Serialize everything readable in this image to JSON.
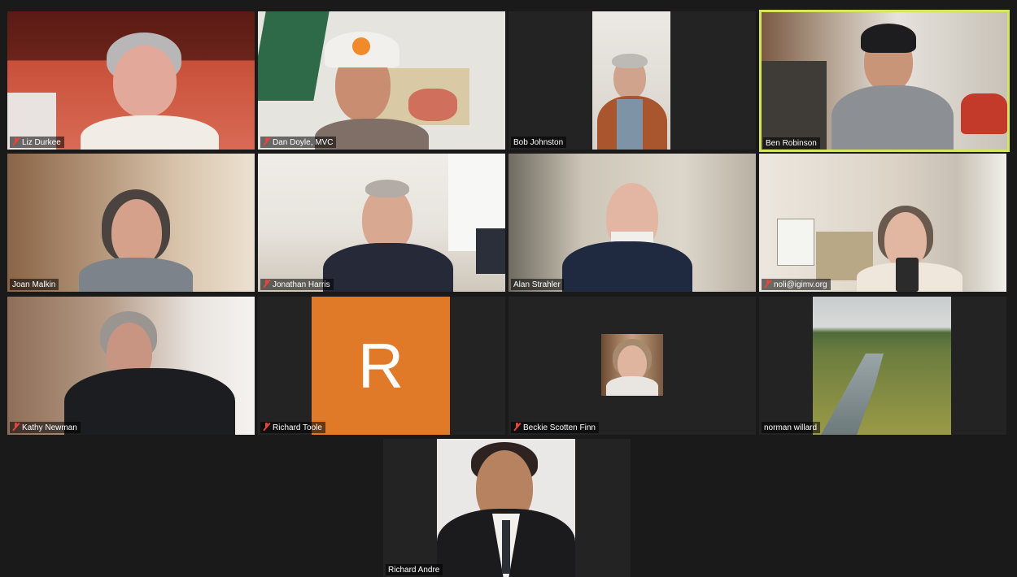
{
  "participants": [
    {
      "name": "Liz Durkee",
      "muted": true
    },
    {
      "name": "Dan Doyle, MVC",
      "muted": true
    },
    {
      "name": "Bob Johnston",
      "muted": false
    },
    {
      "name": "Ben Robinson",
      "muted": false,
      "active_speaker": true
    },
    {
      "name": "Joan Malkin",
      "muted": false
    },
    {
      "name": "Jonathan Harris",
      "muted": true
    },
    {
      "name": "Alan Strahler",
      "muted": false
    },
    {
      "name": "noli@igimv.org",
      "muted": true
    },
    {
      "name": "Kathy Newman",
      "muted": true
    },
    {
      "name": "Richard Toole",
      "muted": true,
      "avatar_letter": "R"
    },
    {
      "name": "Beckie Scotten Finn",
      "muted": true
    },
    {
      "name": "norman willard",
      "muted": false
    },
    {
      "name": "Richard Andre",
      "muted": false
    }
  ],
  "colors": {
    "background": "#1a1a1a",
    "tile": "#232323",
    "active_border": "#d6e65a",
    "muted_icon": "#e0473f",
    "avatar_orange": "#e07a28"
  },
  "icons": {
    "muted": "mic-muted-icon"
  }
}
